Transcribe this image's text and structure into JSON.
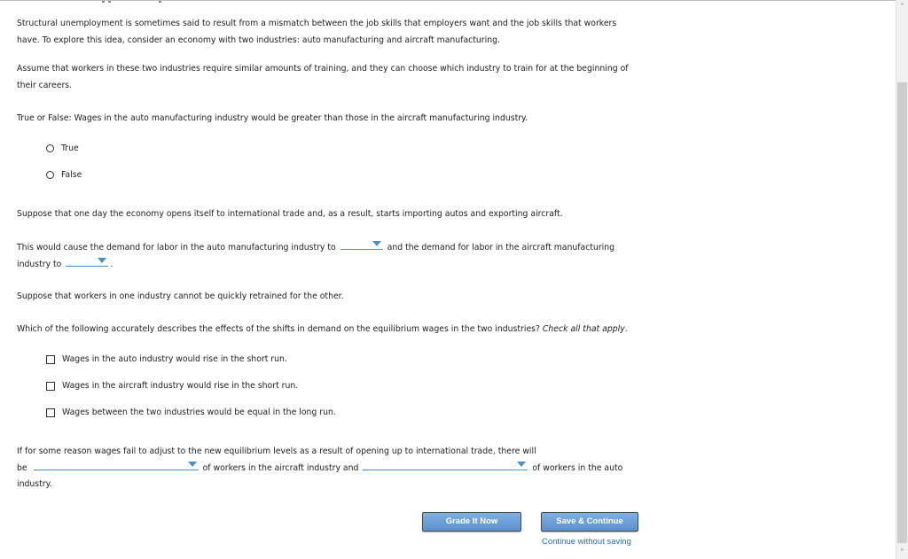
{
  "intro": {
    "line1": "Structural unemployment is sometimes said to result from a mismatch between the job skills that employers want and the job skills that workers",
    "line2": "have. To explore this idea, consider an economy with two industries: auto manufacturing and aircraft manufacturing.",
    "line3": "Assume that workers in these two industries require similar amounts of training, and they can choose which industry to train for at the beginning of",
    "line4": "their careers."
  },
  "q1": {
    "prompt": "True or False: Wages in the auto manufacturing industry would be greater than those in the aircraft manufacturing industry.",
    "options": [
      {
        "label": "True",
        "selected": false
      },
      {
        "label": "False",
        "selected": false
      }
    ]
  },
  "trade_text": "Suppose that one day the economy opens itself to international trade and, as a result, starts importing autos and exporting aircraft.",
  "q2": {
    "part1": "This would cause the demand for labor in the auto manufacturing industry to",
    "part2": "and the demand for labor in the aircraft manufacturing",
    "part3": "industry to",
    "part4": ".",
    "dropdown1_value": "",
    "dropdown2_value": ""
  },
  "retrain_text": "Suppose that workers in one industry cannot be quickly retrained for the other.",
  "q3": {
    "prompt": "Which of the following accurately describes the effects of the shifts in demand on the equilibrium wages in the two industries?",
    "prompt_emphasis": "Check all that apply",
    "prompt_end": ".",
    "options": [
      {
        "label": "Wages in the auto industry would rise in the short run.",
        "checked": false
      },
      {
        "label": "Wages in the aircraft industry would rise in the short run.",
        "checked": false
      },
      {
        "label": "Wages between the two industries would be equal in the long run.",
        "checked": false
      }
    ]
  },
  "q4": {
    "line1": "If for some reason wages fail to adjust to the new equilibrium levels as a result of opening up to international trade, there will",
    "be": "be",
    "mid": "of workers in the aircraft industry and",
    "end": "of workers in the auto",
    "last": "industry.",
    "dropdown1_value": "",
    "dropdown2_value": ""
  },
  "buttons": {
    "grade": "Grade It Now",
    "save": "Save & Continue",
    "continue_link": "Continue without saving"
  },
  "scrollbar": {
    "up_icon": "˄",
    "down_icon": "˅"
  }
}
